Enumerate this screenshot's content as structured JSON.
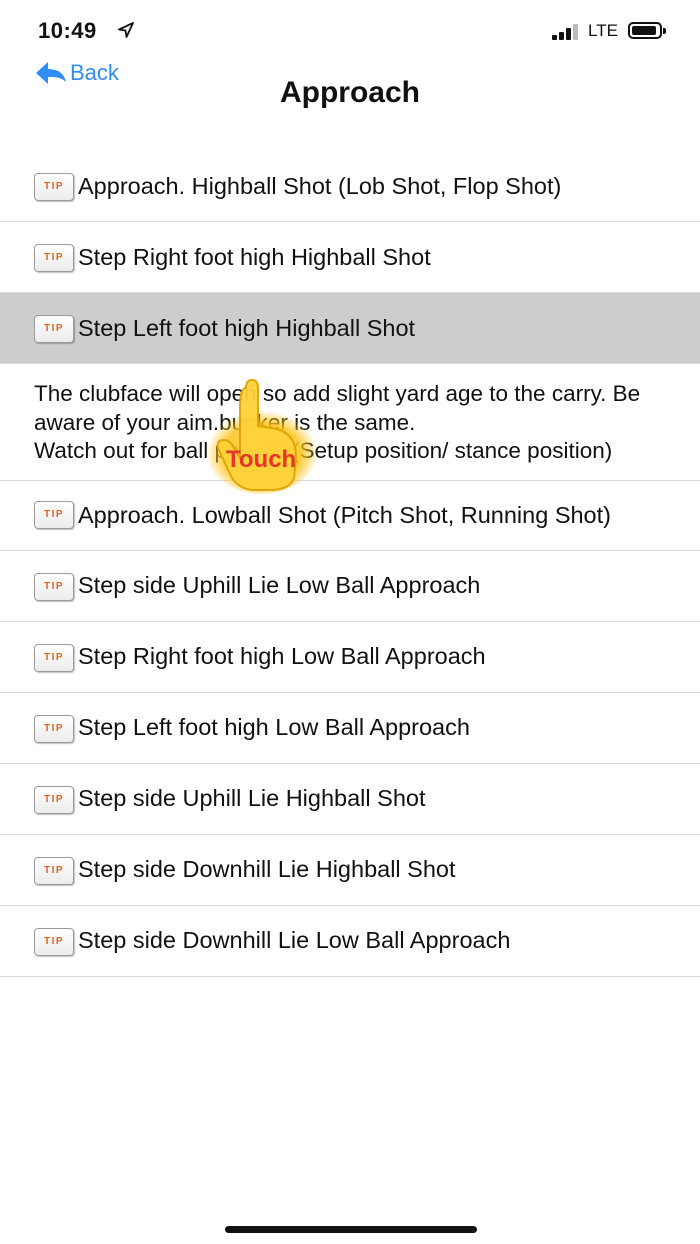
{
  "status_bar": {
    "time": "10:49",
    "network": "LTE"
  },
  "nav": {
    "back_label": "Back",
    "title": "Approach"
  },
  "tip_badge_text": "TIP",
  "items": [
    {
      "label": "Approach. Highball Shot (Lob Shot, Flop Shot)"
    },
    {
      "label": "Step Right foot high Highball Shot"
    },
    {
      "label": "Step Left foot high Highball Shot",
      "selected": true
    },
    {
      "label": "Approach. Lowball Shot (Pitch Shot, Running Shot)"
    },
    {
      "label": "Step side Uphill Lie Low Ball Approach"
    },
    {
      "label": "Step Right foot high Low Ball Approach"
    },
    {
      "label": "Step Left foot high Low Ball Approach"
    },
    {
      "label": "Step side Uphill Lie  Highball Shot"
    },
    {
      "label": "Step  side Downhill Lie Highball Shot"
    },
    {
      "label": "Step side Downhill Lie Low Ball Approach"
    }
  ],
  "expanded_detail": "The clubface will open so add slight yard age to the carry. Be aware of your aim.bunker is the same.\nWatch out for ball position(Setup position/ stance position)",
  "touch_overlay": {
    "label": "Touch"
  },
  "colors": {
    "accent": "#2f8df5",
    "tip_text": "#e0641e",
    "selected_row": "#cdcdcd",
    "touch_label": "#e8342c"
  }
}
